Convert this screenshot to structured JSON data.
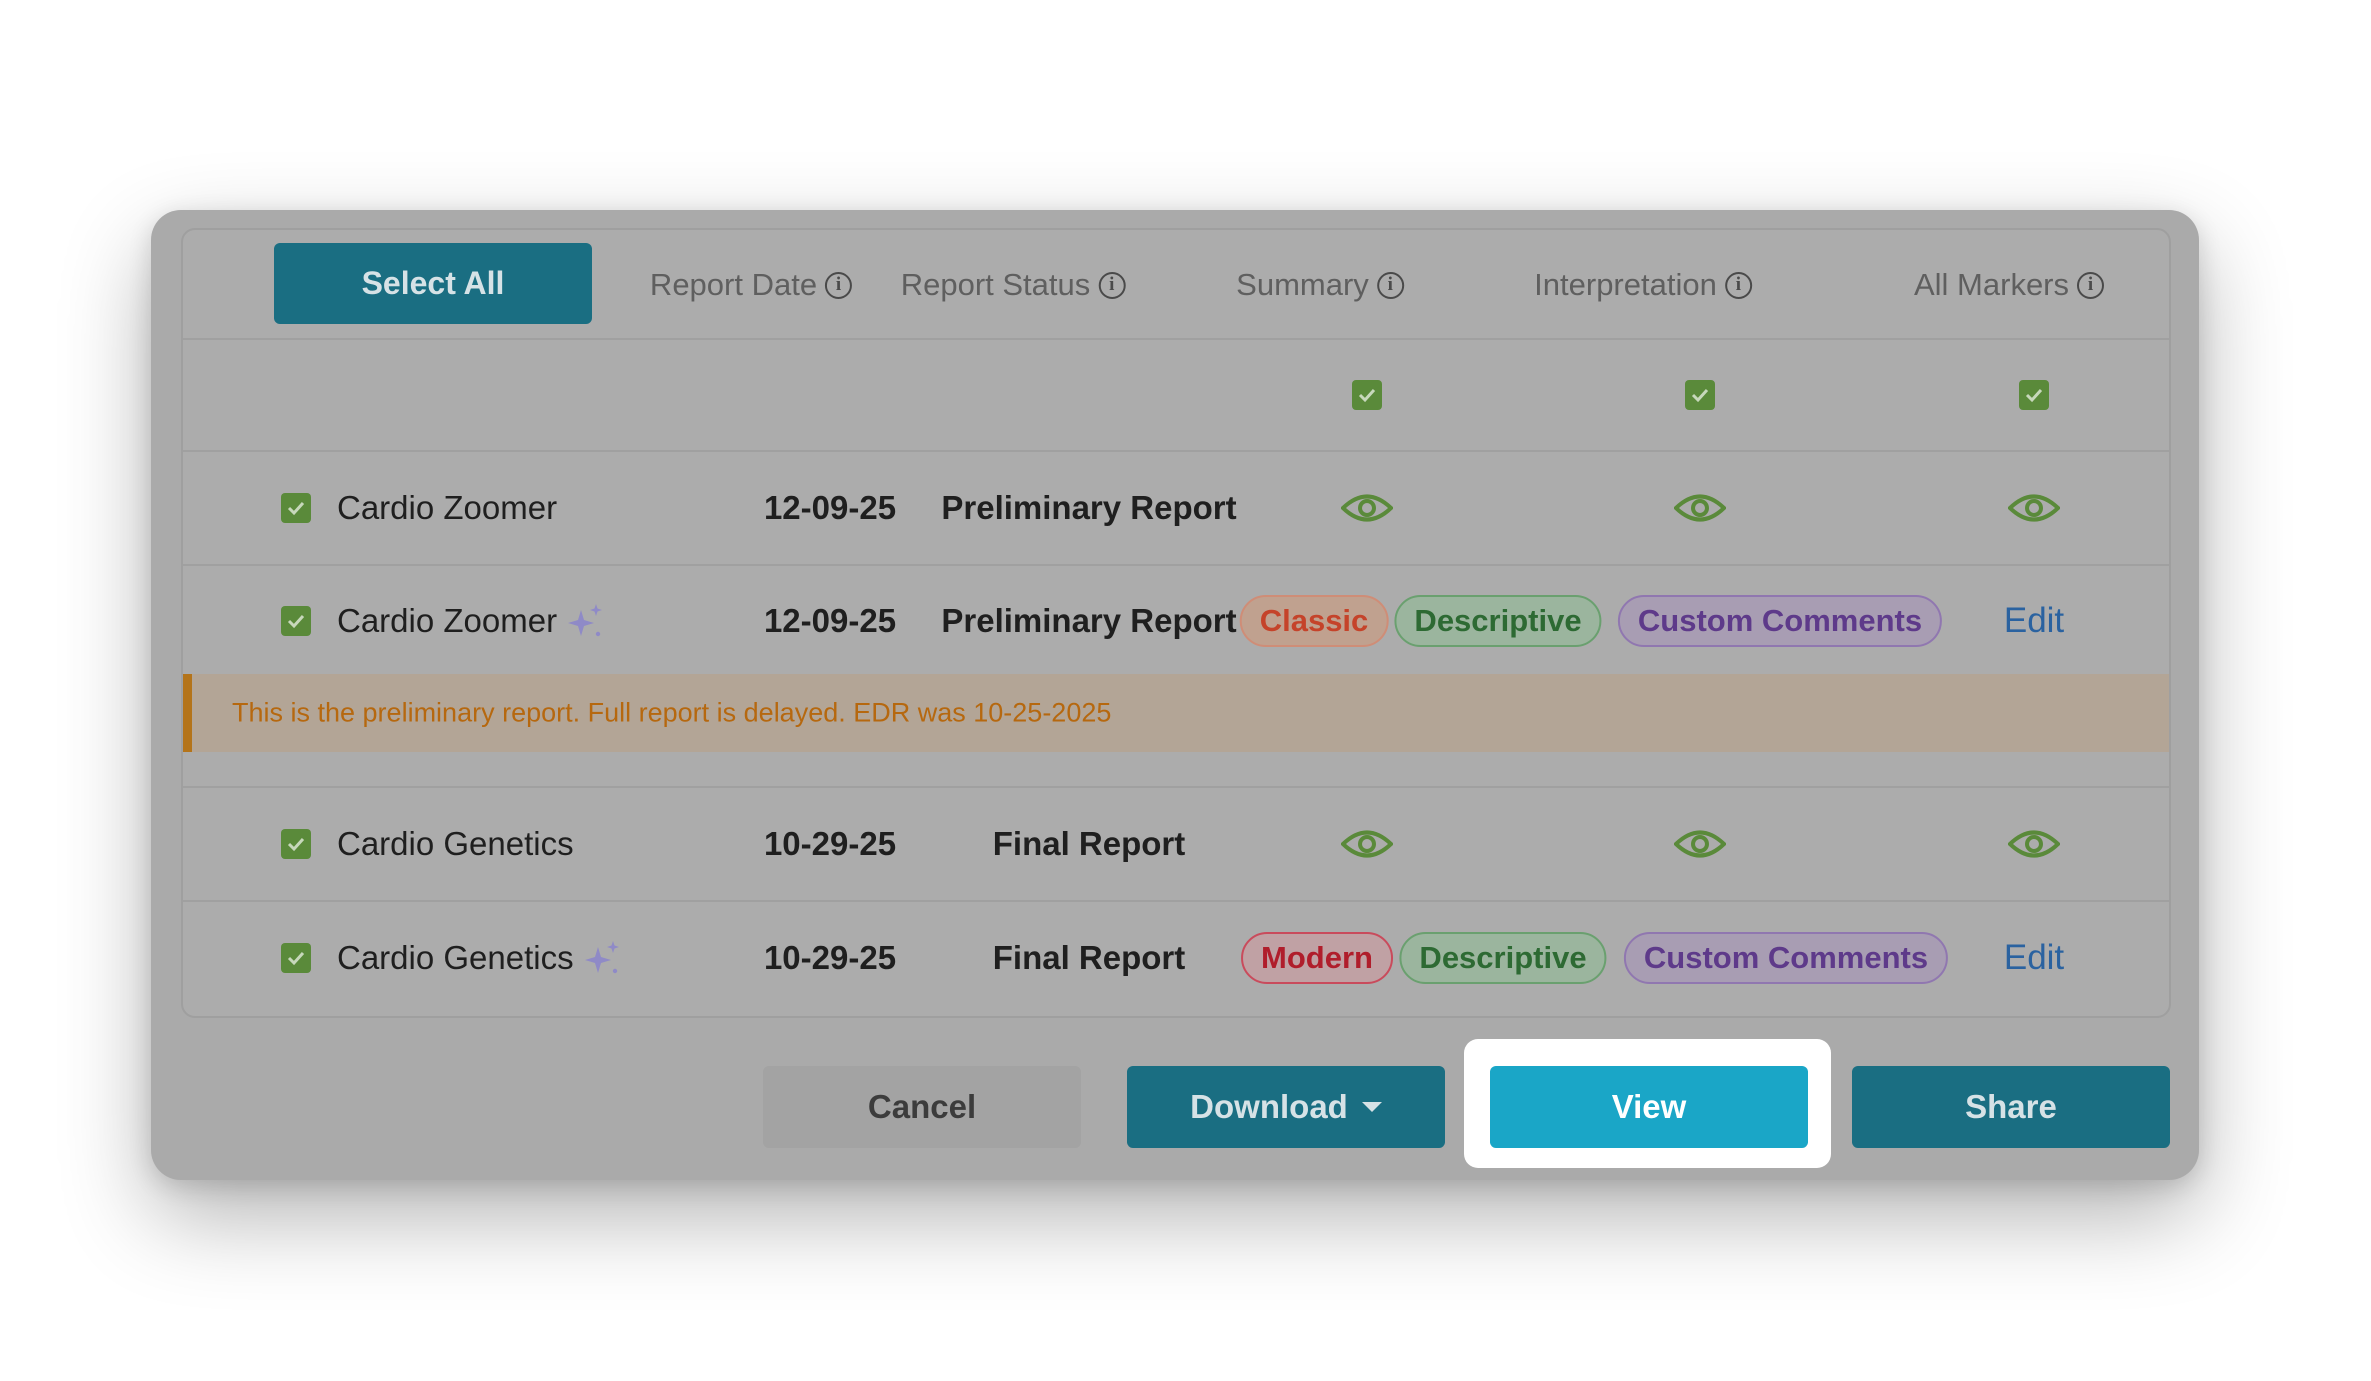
{
  "header": {
    "select_all_label": "Select All",
    "columns": [
      "Report Date",
      "Report Status",
      "Summary",
      "Interpretation",
      "All Markers"
    ],
    "info_glyph": "i"
  },
  "rows": [
    {
      "name": "Cardio Zoomer",
      "date": "12-09-25",
      "status": "Preliminary Report",
      "ai": false
    },
    {
      "name": "Cardio Zoomer",
      "date": "12-09-25",
      "status": "Preliminary Report",
      "ai": true,
      "summary_tag": "Classic",
      "interpretation_tag": "Descriptive",
      "markers_tag": "Custom Comments",
      "action": "Edit"
    },
    {
      "name": "Cardio Genetics",
      "date": "10-29-25",
      "status": "Final Report",
      "ai": false
    },
    {
      "name": "Cardio Genetics",
      "date": "10-29-25",
      "status": "Final Report",
      "ai": true,
      "summary_tag": "Modern",
      "interpretation_tag": "Descriptive",
      "markers_tag": "Custom Comments",
      "action": "Edit"
    }
  ],
  "alert": {
    "text": "This is the preliminary report. Full report is delayed. EDR was 10-25-2025"
  },
  "footer": {
    "cancel": "Cancel",
    "download": "Download",
    "view": "View",
    "share": "Share"
  },
  "colors": {
    "primary": "#1a6e82",
    "view_highlight": "#1aa6c7",
    "checkbox": "#5a8a3a",
    "alert_accent": "#b4741a"
  },
  "icons": {
    "checkbox": "checkbox-checked-icon",
    "eye": "eye-icon",
    "sparkle": "sparkle-icon",
    "info": "info-icon",
    "caret": "caret-down-icon"
  }
}
